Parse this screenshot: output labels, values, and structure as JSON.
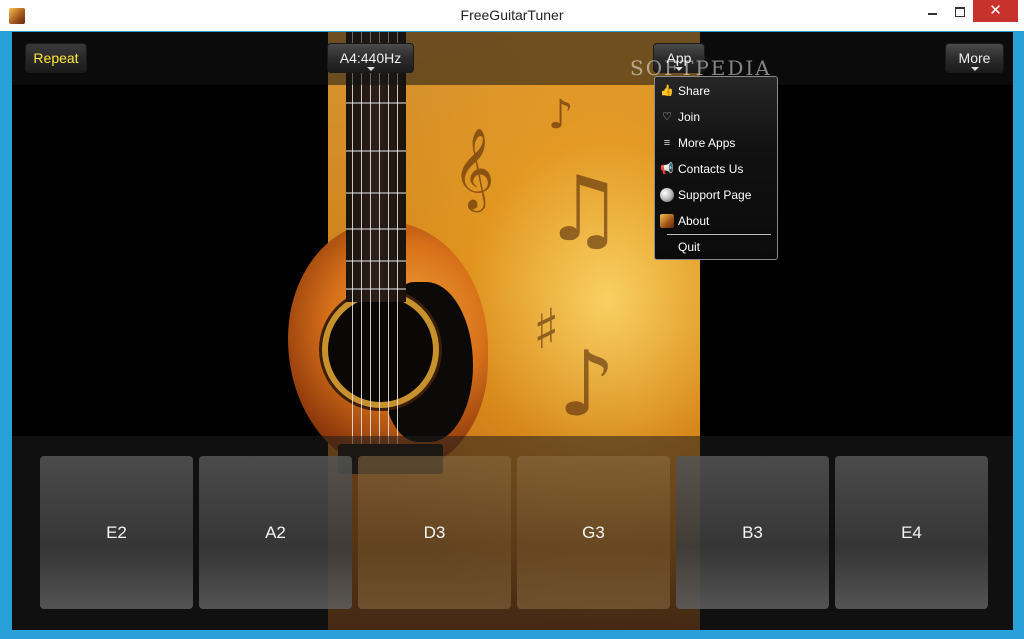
{
  "window": {
    "title": "FreeGuitarTuner",
    "controls": {
      "close": "✕"
    }
  },
  "toolbar": {
    "repeat_label": "Repeat",
    "reference_label": "A4:440Hz",
    "app_label": "App",
    "more_label": "More"
  },
  "watermark": "SOFTPEDIA",
  "app_menu": {
    "items": [
      {
        "label": "Share",
        "icon": "share-icon"
      },
      {
        "label": "Join",
        "icon": "heart-icon"
      },
      {
        "label": "More Apps",
        "icon": "list-icon"
      },
      {
        "label": "Contacts Us",
        "icon": "megaphone-icon"
      },
      {
        "label": "Support Page",
        "icon": "globe-icon"
      },
      {
        "label": "About",
        "icon": "app-icon"
      },
      {
        "label": "Quit",
        "icon": ""
      }
    ]
  },
  "strings": [
    {
      "label": "E2"
    },
    {
      "label": "A2"
    },
    {
      "label": "D3"
    },
    {
      "label": "G3"
    },
    {
      "label": "B3"
    },
    {
      "label": "E4"
    }
  ],
  "colors": {
    "repeat_text": "#ffe83a",
    "close_button": "#c7332c",
    "client_background": "#000000"
  }
}
